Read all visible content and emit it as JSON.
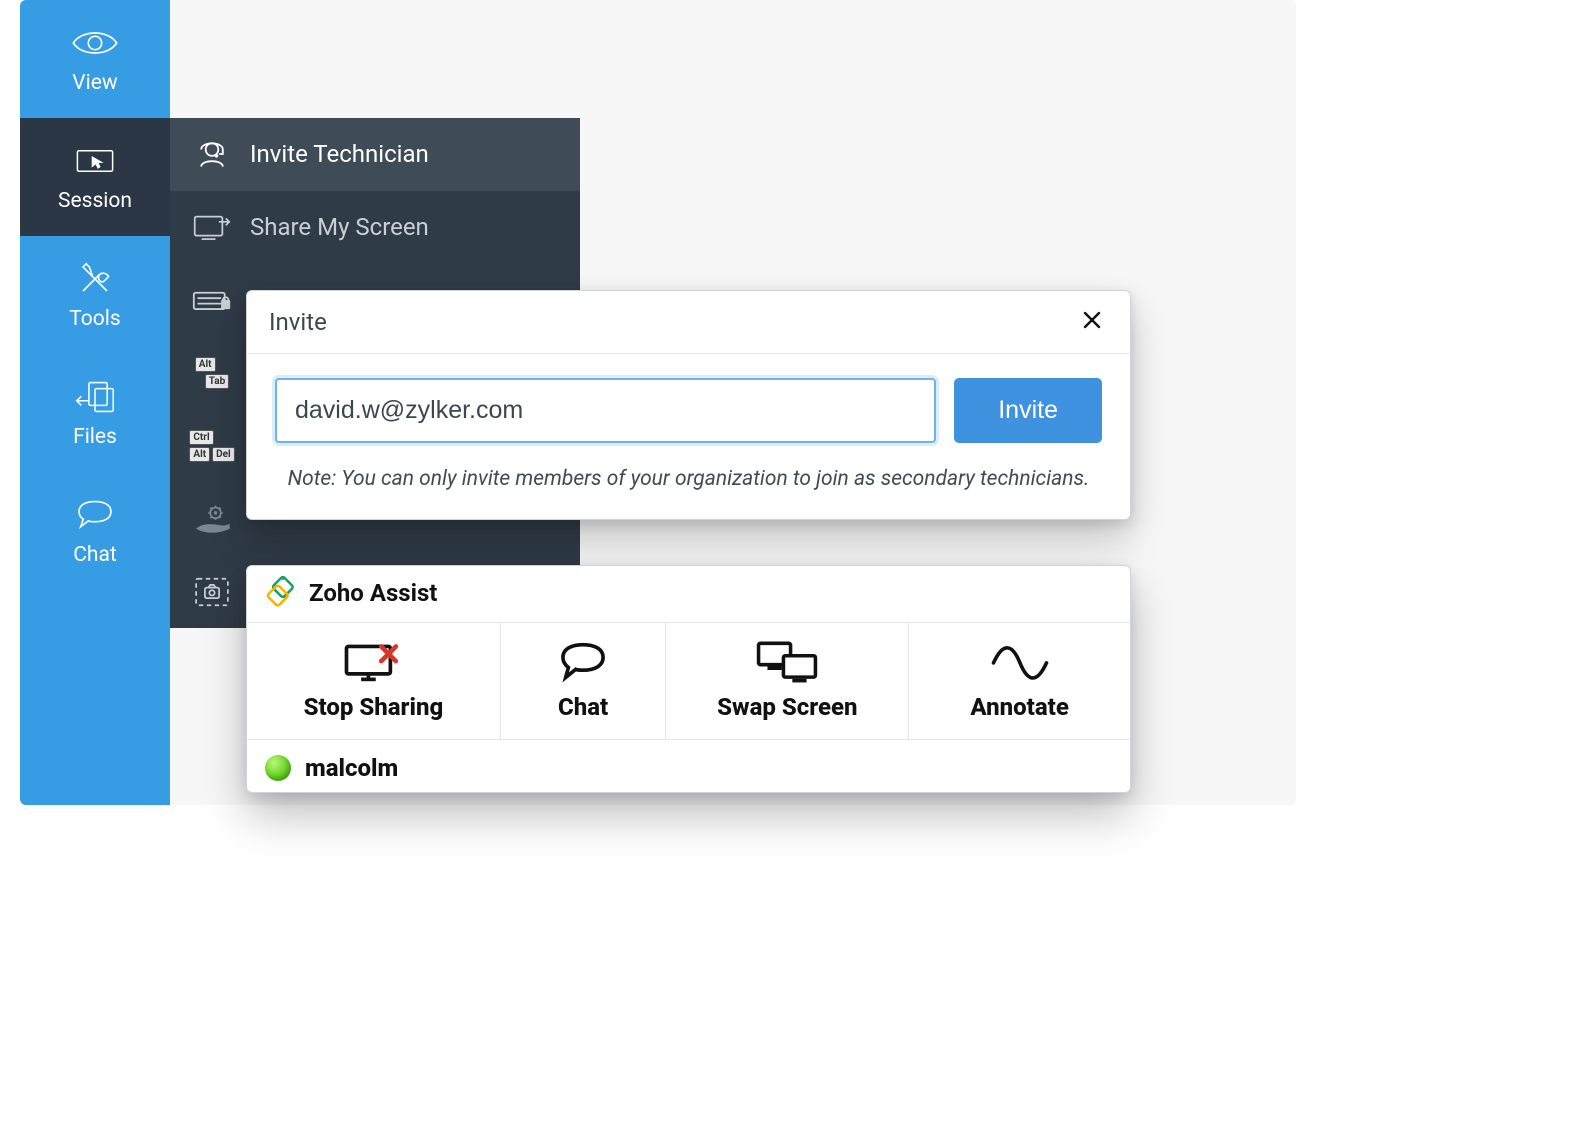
{
  "sidebar": {
    "items": [
      {
        "label": "View"
      },
      {
        "label": "Session"
      },
      {
        "label": "Tools"
      },
      {
        "label": "Files"
      },
      {
        "label": "Chat"
      }
    ]
  },
  "submenu": {
    "invite_technician": "Invite Technician",
    "share_my_screen": "Share My Screen",
    "keys_alt_tab_alt": "Alt",
    "keys_alt_tab_tab": "Tab",
    "keys_cad_ctrl": "Ctrl",
    "keys_cad_alt": "Alt",
    "keys_cad_del": "Del"
  },
  "invite": {
    "title": "Invite",
    "email_value": "david.w@zylker.com",
    "button_label": "Invite",
    "note_text": "Note: You can only invite members of your organization to join as secondary technicians."
  },
  "assist": {
    "brand": "Zoho Assist",
    "actions": {
      "stop_sharing": "Stop Sharing",
      "chat": "Chat",
      "swap_screen": "Swap Screen",
      "annotate": "Annotate"
    },
    "user": {
      "name": "malcolm"
    }
  }
}
